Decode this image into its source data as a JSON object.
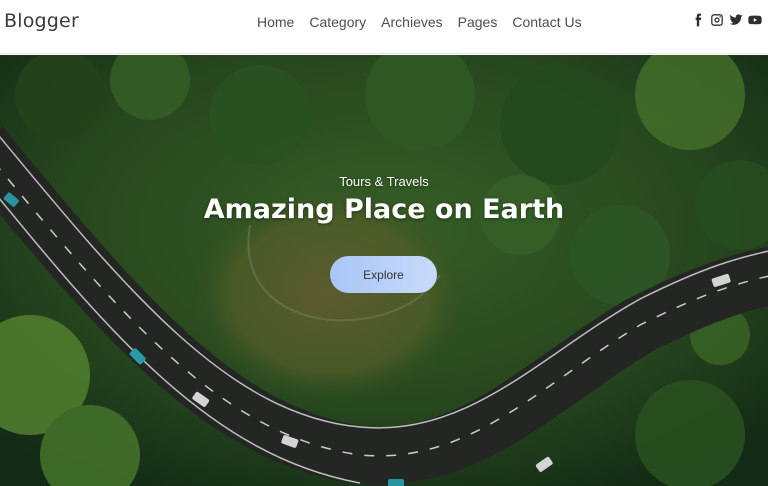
{
  "header": {
    "brand": "Blogger",
    "nav": [
      {
        "label": "Home"
      },
      {
        "label": "Category"
      },
      {
        "label": "Archieves"
      },
      {
        "label": "Pages"
      },
      {
        "label": "Contact Us"
      }
    ],
    "social_icons": [
      "facebook-icon",
      "instagram-icon",
      "twitter-icon",
      "youtube-icon"
    ]
  },
  "hero": {
    "subtitle": "Tours & Travels",
    "title": "Amazing Place on Earth",
    "button_label": "Explore"
  },
  "colors": {
    "button_gradient_start": "#a8c6f5",
    "button_gradient_end": "#c9dafc",
    "forest": "#2e5a26",
    "road": "#2a2c2a"
  }
}
